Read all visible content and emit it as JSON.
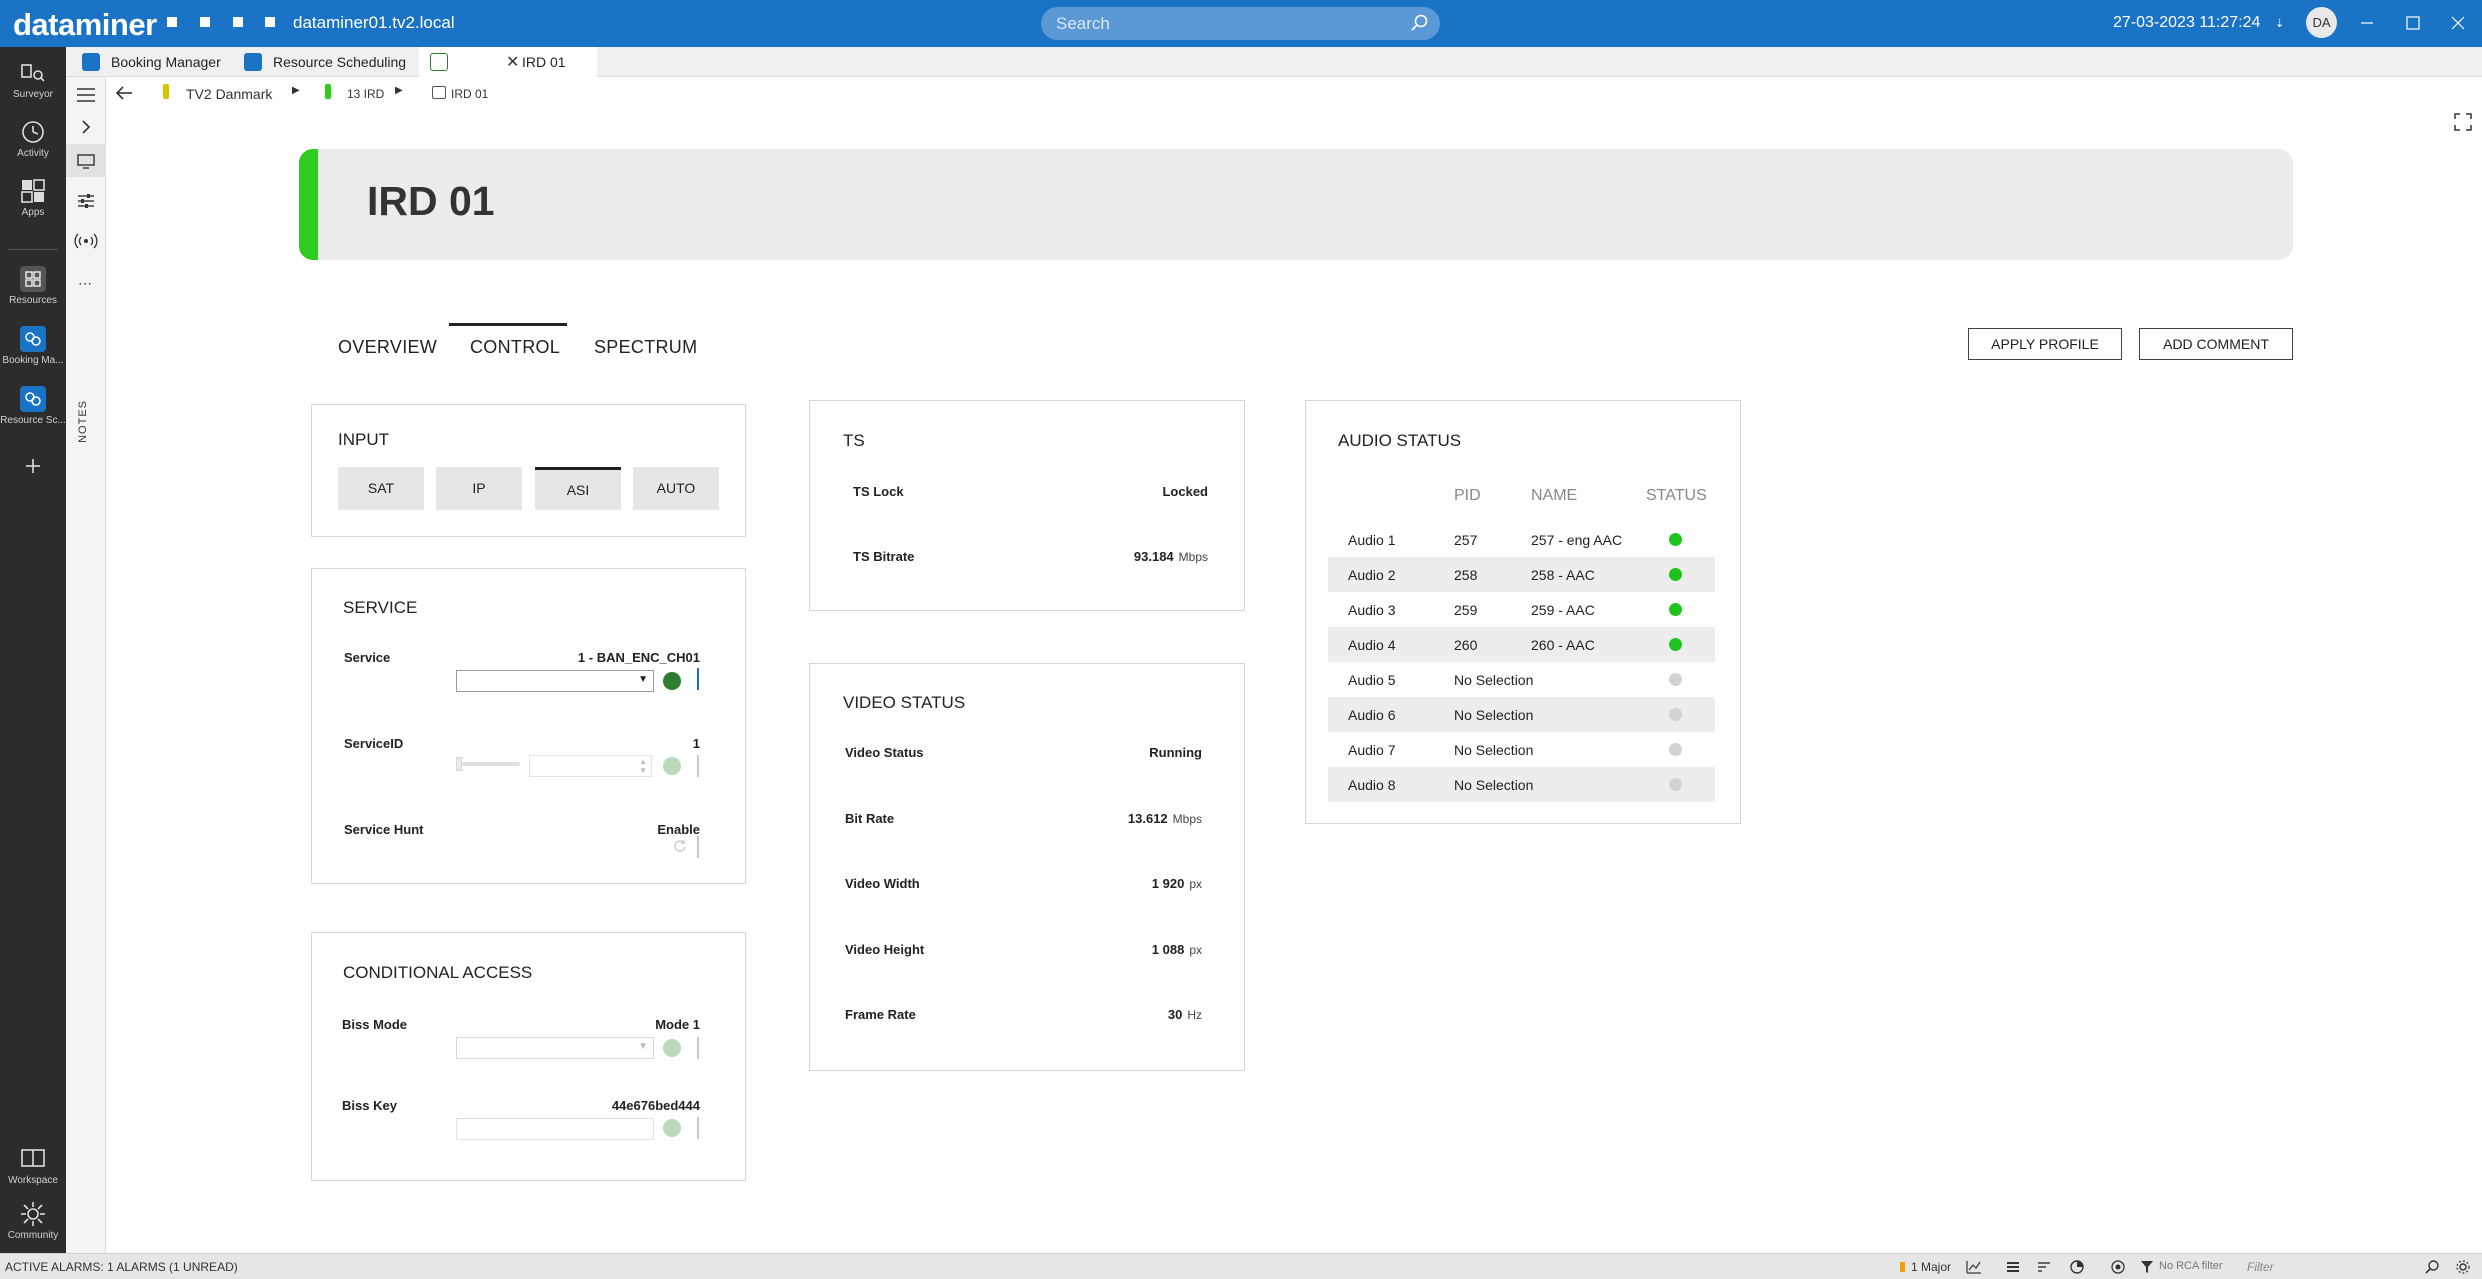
{
  "titlebar": {
    "logo": "dataminer",
    "hostname": "dataminer01.tv2.local",
    "search_placeholder": "Search",
    "datetime": "27-03-2023 11:27:24",
    "avatar": "DA"
  },
  "appbar": {
    "items": [
      {
        "label": "Surveyor",
        "icon": "surveyor-icon"
      },
      {
        "label": "Activity",
        "icon": "activity-icon"
      },
      {
        "label": "Apps",
        "icon": "apps-icon"
      },
      {
        "label": "Resources",
        "icon": "resources-icon"
      },
      {
        "label": "Booking Ma...",
        "icon": "booking-manager-icon"
      },
      {
        "label": "Resource Sc...",
        "icon": "resource-scheduling-icon"
      },
      {
        "label": "Workspace",
        "icon": "workspace-icon"
      },
      {
        "label": "Community",
        "icon": "community-icon"
      }
    ]
  },
  "tabs": [
    {
      "label": "Booking Manager"
    },
    {
      "label": "Resource Scheduling"
    },
    {
      "label": "IRD 01"
    }
  ],
  "sidetool": {
    "notes_label": "NOTES"
  },
  "breadcrumb": [
    "TV2 Danmark",
    "13 IRD",
    "IRD 01"
  ],
  "header": {
    "title": "IRD 01",
    "status_color": "#2ecc1e"
  },
  "page_tabs": [
    "OVERVIEW",
    "CONTROL",
    "SPECTRUM"
  ],
  "actions": {
    "apply_profile": "APPLY PROFILE",
    "add_comment": "ADD COMMENT"
  },
  "input": {
    "title": "INPUT",
    "options": [
      "SAT",
      "IP",
      "ASI",
      "AUTO"
    ],
    "selected": "ASI"
  },
  "service": {
    "title": "SERVICE",
    "service_label": "Service",
    "service_value": "1 - BAN_ENC_CH01",
    "serviceid_label": "ServiceID",
    "serviceid_value": "1",
    "hunt_label": "Service Hunt",
    "hunt_value": "Enable"
  },
  "conditional_access": {
    "title": "CONDITIONAL ACCESS",
    "biss_mode_label": "Biss Mode",
    "biss_mode_value": "Mode 1",
    "biss_key_label": "Biss Key",
    "biss_key_value": "44e676bed444"
  },
  "ts": {
    "title": "TS",
    "lock_label": "TS Lock",
    "lock_value": "Locked",
    "bitrate_label": "TS Bitrate",
    "bitrate_value": "93.184",
    "bitrate_unit": "Mbps"
  },
  "video_status": {
    "title": "VIDEO STATUS",
    "rows": [
      {
        "label": "Video Status",
        "value": "Running",
        "unit": ""
      },
      {
        "label": "Bit Rate",
        "value": "13.612",
        "unit": "Mbps"
      },
      {
        "label": "Video Width",
        "value": "1 920",
        "unit": "px"
      },
      {
        "label": "Video Height",
        "value": "1 088",
        "unit": "px"
      },
      {
        "label": "Frame Rate",
        "value": "30",
        "unit": "Hz"
      }
    ]
  },
  "audio_status": {
    "title": "AUDIO STATUS",
    "columns": [
      "PID",
      "NAME",
      "STATUS"
    ],
    "rows": [
      {
        "audio": "Audio 1",
        "pid": "257",
        "name": "257 -  eng AAC",
        "status_color": "#1ec31e"
      },
      {
        "audio": "Audio 2",
        "pid": "258",
        "name": "258 -  AAC",
        "status_color": "#1ec31e"
      },
      {
        "audio": "Audio 3",
        "pid": "259",
        "name": "259 -  AAC",
        "status_color": "#1ec31e"
      },
      {
        "audio": "Audio 4",
        "pid": "260",
        "name": "260 -  AAC",
        "status_color": "#1ec31e"
      },
      {
        "audio": "Audio 5",
        "pid": "No Selection",
        "name": "",
        "status_color": "#d3d3d3"
      },
      {
        "audio": "Audio 6",
        "pid": "No Selection",
        "name": "",
        "status_color": "#d3d3d3"
      },
      {
        "audio": "Audio 7",
        "pid": "No Selection",
        "name": "",
        "status_color": "#d3d3d3"
      },
      {
        "audio": "Audio 8",
        "pid": "No Selection",
        "name": "",
        "status_color": "#d3d3d3"
      }
    ]
  },
  "statusbar": {
    "alarms": "ACTIVE ALARMS: 1 ALARMS (1 UNREAD)",
    "major": "1 Major",
    "rca_filter": "No RCA filter",
    "filter_placeholder": "Filter"
  }
}
